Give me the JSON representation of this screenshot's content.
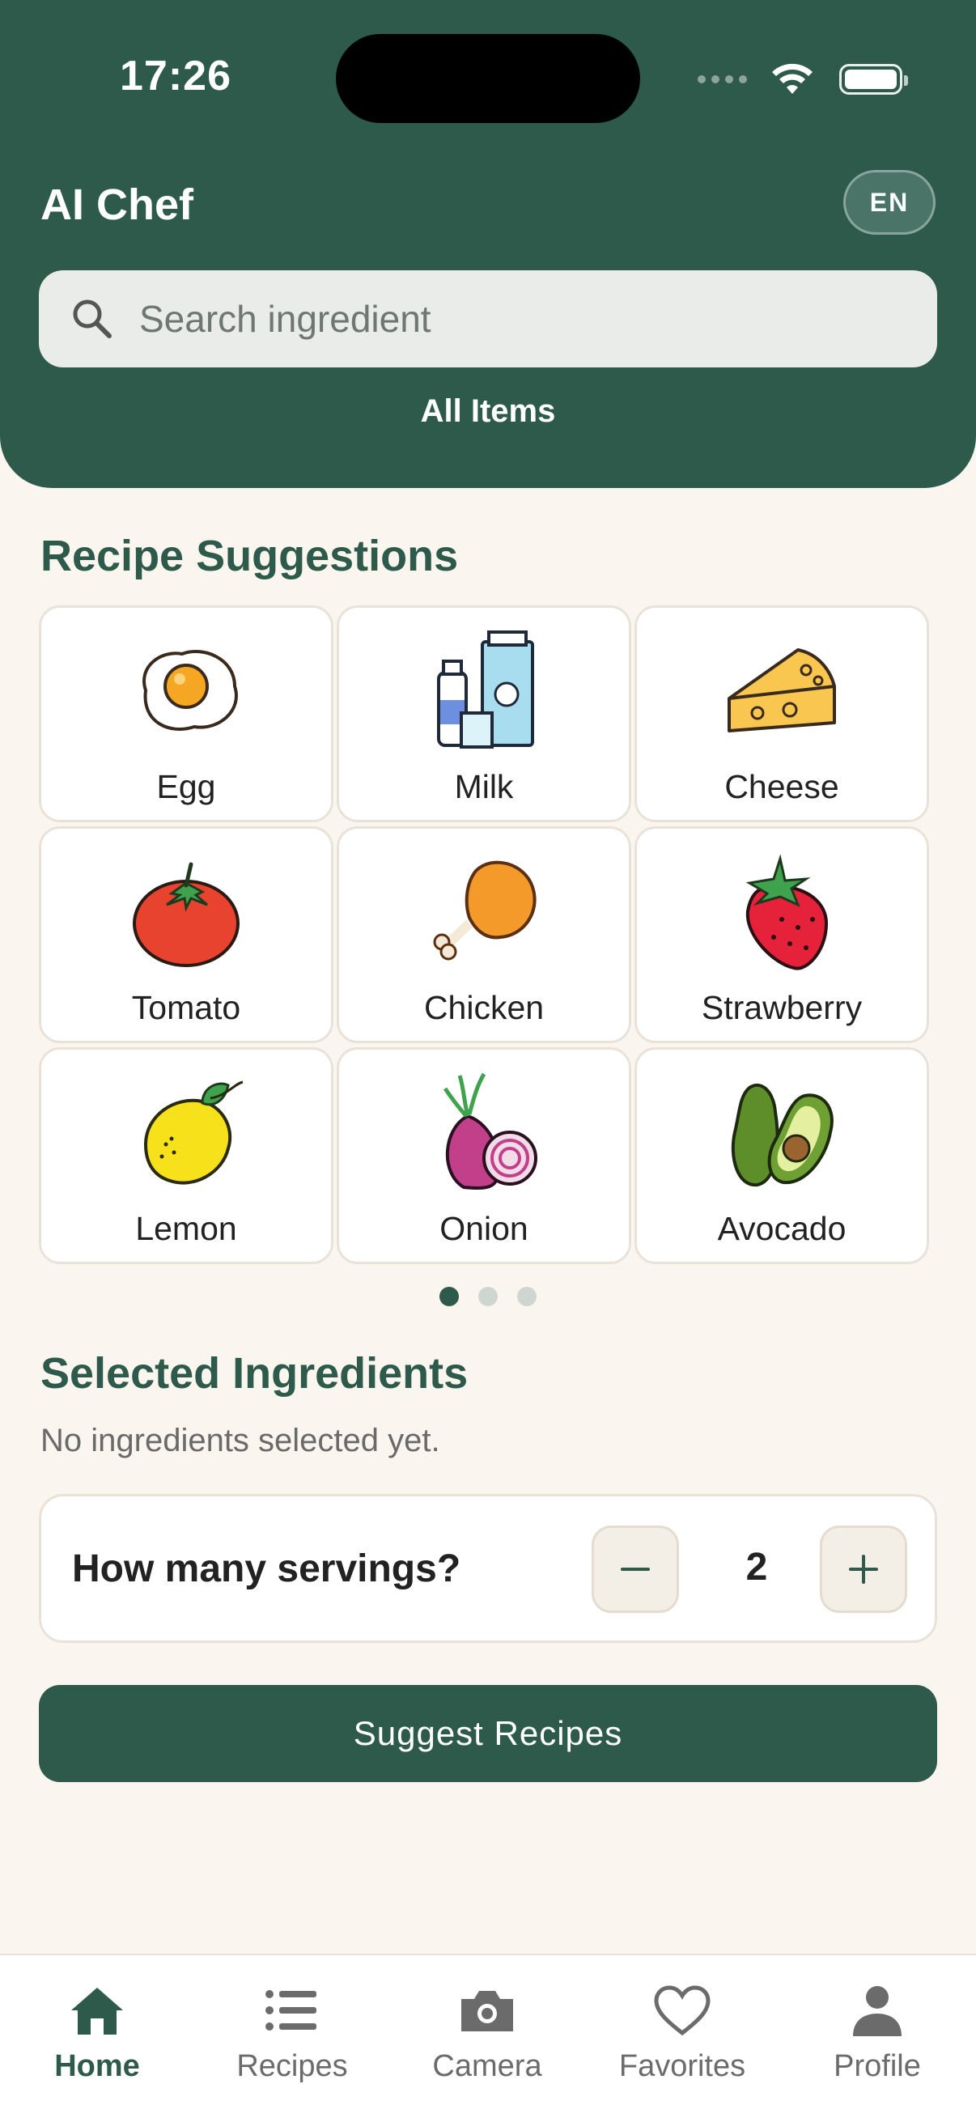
{
  "status_bar": {
    "time": "17:26"
  },
  "header": {
    "title": "AI Chef",
    "language": "EN",
    "search_placeholder": "Search ingredient",
    "filter_label": "All Items"
  },
  "suggestions": {
    "title": "Recipe Suggestions",
    "items": [
      {
        "label": "Egg",
        "icon": "egg-icon"
      },
      {
        "label": "Milk",
        "icon": "milk-icon"
      },
      {
        "label": "Cheese",
        "icon": "cheese-icon"
      },
      {
        "label": "Tomato",
        "icon": "tomato-icon"
      },
      {
        "label": "Chicken",
        "icon": "chicken-icon"
      },
      {
        "label": "Strawberry",
        "icon": "strawberry-icon"
      },
      {
        "label": "Lemon",
        "icon": "lemon-icon"
      },
      {
        "label": "Onion",
        "icon": "onion-icon"
      },
      {
        "label": "Avocado",
        "icon": "avocado-icon"
      }
    ],
    "pages": 3,
    "active_page": 1
  },
  "selected": {
    "title": "Selected Ingredients",
    "empty_text": "No ingredients selected yet."
  },
  "servings": {
    "label": "How many servings?",
    "value": "2"
  },
  "cta": {
    "label": "Suggest Recipes"
  },
  "tabbar": {
    "items": [
      {
        "label": "Home",
        "icon": "home-icon",
        "active": true
      },
      {
        "label": "Recipes",
        "icon": "list-icon",
        "active": false
      },
      {
        "label": "Camera",
        "icon": "camera-icon",
        "active": false
      },
      {
        "label": "Favorites",
        "icon": "heart-icon",
        "active": false
      },
      {
        "label": "Profile",
        "icon": "person-icon",
        "active": false
      }
    ]
  },
  "colors": {
    "brand": "#2E5A4C",
    "background": "#FBF5EF",
    "card_border": "#E9E2D9"
  }
}
